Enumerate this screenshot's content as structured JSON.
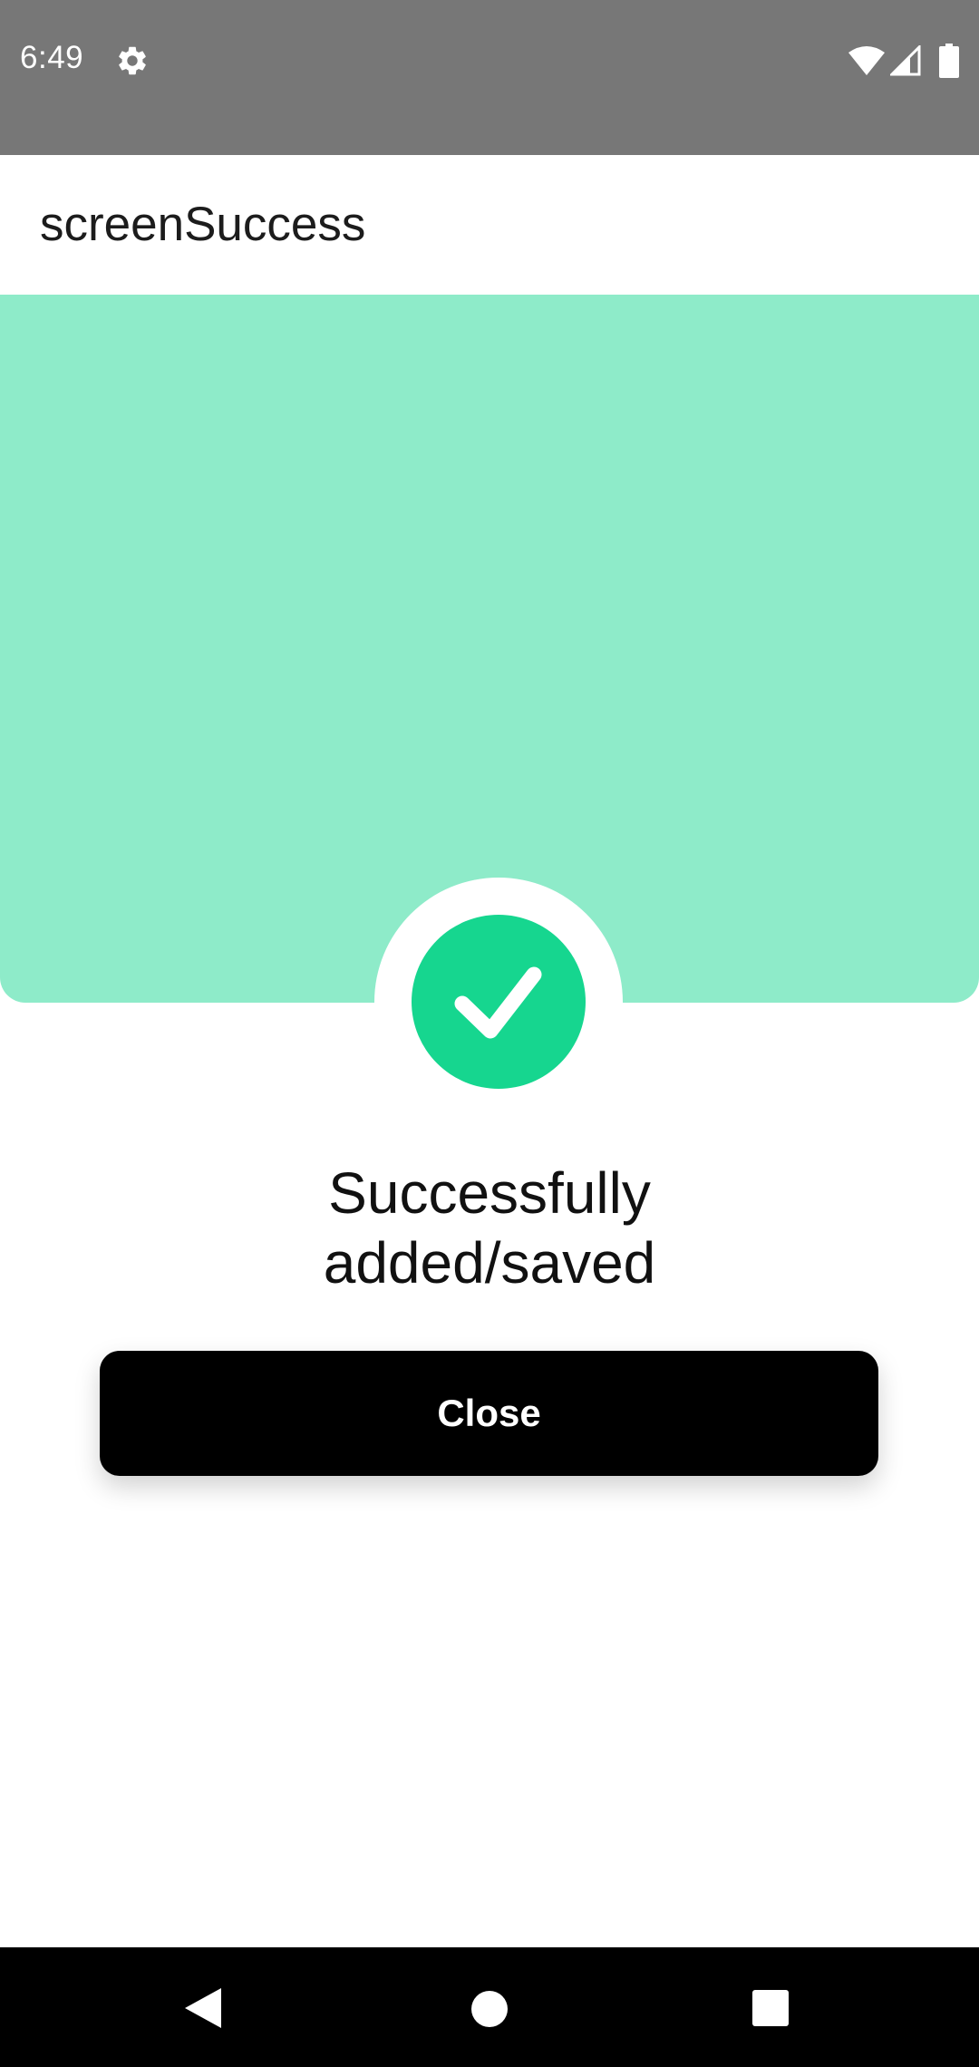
{
  "status_bar": {
    "time": "6:49",
    "icons": [
      "settings-icon",
      "wifi-icon",
      "signal-icon",
      "battery-icon"
    ]
  },
  "app_bar": {
    "title": "screenSuccess"
  },
  "success": {
    "icon": "check-icon",
    "message_line_1": "Successfully",
    "message_line_2": "added/saved"
  },
  "actions": {
    "close_label": "Close"
  },
  "nav_bar": {
    "icons": [
      "back-icon",
      "home-icon",
      "recents-icon"
    ]
  },
  "colors": {
    "hero_background": "#8eebc9",
    "success_accent": "#16d68f",
    "button_background": "#000000",
    "status_bar": "#777777"
  }
}
